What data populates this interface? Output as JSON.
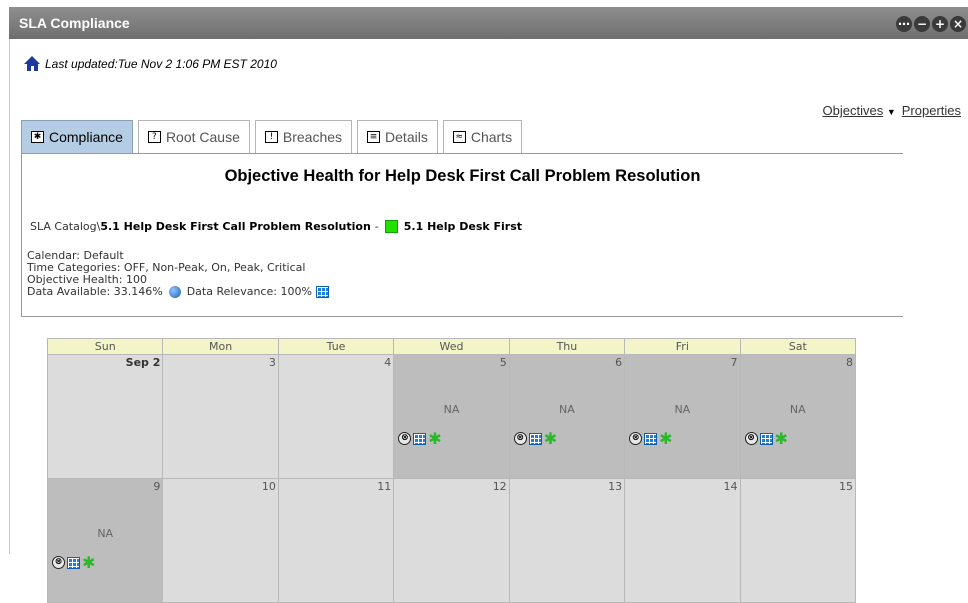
{
  "window": {
    "title": "SLA Compliance",
    "buttons": [
      "⋯",
      "−",
      "+",
      "×"
    ]
  },
  "last_updated": "Last updated:Tue Nov 2 1:06 PM EST 2010",
  "links": {
    "objectives": "Objectives",
    "properties": "Properties"
  },
  "tabs": [
    {
      "label": "Compliance",
      "icon": "✱",
      "active": true
    },
    {
      "label": "Root Cause",
      "icon": "?",
      "active": false
    },
    {
      "label": "Breaches",
      "icon": "!",
      "active": false
    },
    {
      "label": "Details",
      "icon": "≡",
      "active": false
    },
    {
      "label": "Charts",
      "icon": "≈",
      "active": false
    }
  ],
  "health": {
    "title": "Objective Health for Help Desk First Call Problem Resolution",
    "catalog_prefix": "SLA Catalog\\",
    "catalog_name": "5.1 Help Desk First Call Problem Resolution",
    "catalog_sep": "-",
    "status_name": "5.1 Help Desk First",
    "status_color": "#22e000",
    "calendar": "Calendar: Default",
    "time_categories": "Time Categories: OFF, Non-Peak, On, Peak, Critical",
    "objective_health": "Objective Health: 100",
    "data_available": "Data Available: 33.146%",
    "data_relevance": "Data Relevance: 100%"
  },
  "calendar": {
    "days": [
      "Sun",
      "Mon",
      "Tue",
      "Wed",
      "Thu",
      "Fri",
      "Sat"
    ],
    "weeks": [
      [
        {
          "num": "Sep 2",
          "bold": true,
          "na": false
        },
        {
          "num": "3",
          "na": false
        },
        {
          "num": "4",
          "na": false
        },
        {
          "num": "5",
          "na": true,
          "na_label": "NA"
        },
        {
          "num": "6",
          "na": true,
          "na_label": "NA"
        },
        {
          "num": "7",
          "na": true,
          "na_label": "NA"
        },
        {
          "num": "8",
          "na": true,
          "na_label": "NA"
        }
      ],
      [
        {
          "num": "9",
          "na": true,
          "na_label": "NA"
        },
        {
          "num": "10",
          "na": false
        },
        {
          "num": "11",
          "na": false
        },
        {
          "num": "12",
          "na": false
        },
        {
          "num": "13",
          "na": false
        },
        {
          "num": "14",
          "na": false
        },
        {
          "num": "15",
          "na": false
        }
      ]
    ],
    "icons": {
      "x_glyph": "⊗",
      "star_glyph": "✱"
    }
  }
}
